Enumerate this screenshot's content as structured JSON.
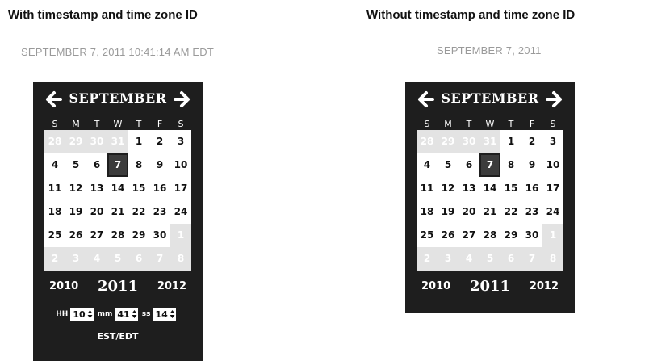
{
  "left": {
    "heading": "With timestamp and time zone ID",
    "date_value": "SEPTEMBER 7, 2011 10:41:14 AM EDT",
    "calendar": {
      "month": "SEPTEMBER",
      "dows": [
        "S",
        "M",
        "T",
        "W",
        "T",
        "F",
        "S"
      ],
      "weeks": [
        [
          "28",
          "29",
          "30",
          "31",
          "1",
          "2",
          "3"
        ],
        [
          "4",
          "5",
          "6",
          "7",
          "8",
          "9",
          "10"
        ],
        [
          "11",
          "12",
          "13",
          "14",
          "15",
          "16",
          "17"
        ],
        [
          "18",
          "19",
          "20",
          "21",
          "22",
          "23",
          "24"
        ],
        [
          "25",
          "26",
          "27",
          "28",
          "29",
          "30",
          "1"
        ],
        [
          "2",
          "3",
          "4",
          "5",
          "6",
          "7",
          "8"
        ]
      ],
      "year_prev": "2010",
      "year_current": "2011",
      "year_next": "2012",
      "time": {
        "hh_label": "HH",
        "hh_value": "10",
        "mm_label": "mm",
        "mm_value": "41",
        "ss_label": "ss",
        "ss_value": "14"
      },
      "timezone": "EST/EDT"
    }
  },
  "right": {
    "heading": "Without timestamp and time zone ID",
    "date_value": "SEPTEMBER 7, 2011",
    "calendar": {
      "month": "SEPTEMBER",
      "dows": [
        "S",
        "M",
        "T",
        "W",
        "T",
        "F",
        "S"
      ],
      "weeks": [
        [
          "28",
          "29",
          "30",
          "31",
          "1",
          "2",
          "3"
        ],
        [
          "4",
          "5",
          "6",
          "7",
          "8",
          "9",
          "10"
        ],
        [
          "11",
          "12",
          "13",
          "14",
          "15",
          "16",
          "17"
        ],
        [
          "18",
          "19",
          "20",
          "21",
          "22",
          "23",
          "24"
        ],
        [
          "25",
          "26",
          "27",
          "28",
          "29",
          "30",
          "1"
        ],
        [
          "2",
          "3",
          "4",
          "5",
          "6",
          "7",
          "8"
        ]
      ],
      "year_prev": "2010",
      "year_current": "2011",
      "year_next": "2012"
    }
  },
  "calendar_info": {
    "selected_day": "7",
    "leading_other_month_days": 4,
    "trailing_other_month_days": 8
  },
  "colors": {
    "calendar_bg": "#1e1e1e",
    "selected_day_bg": "#3c3c3c",
    "other_month_bg": "#e3e3e3",
    "date_text": "#9a9a9a"
  }
}
